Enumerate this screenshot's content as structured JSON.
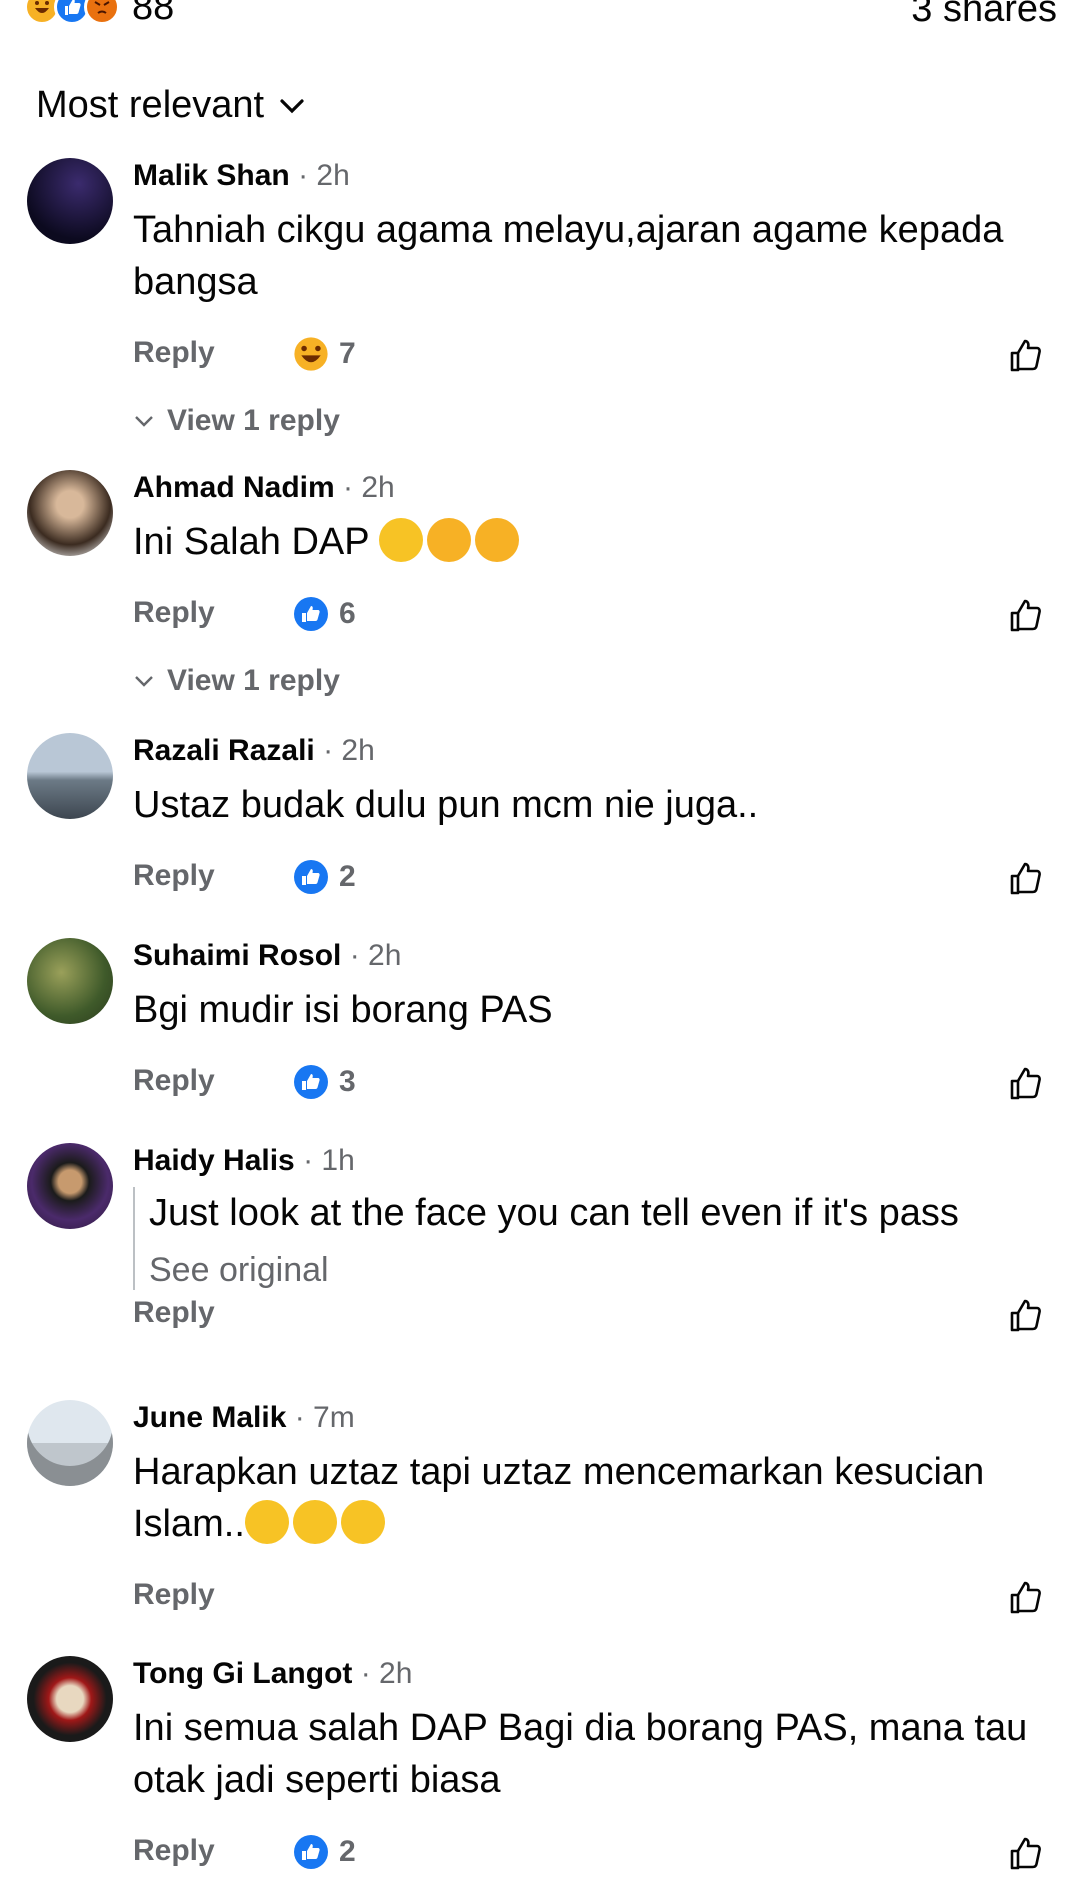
{
  "header": {
    "reaction_count": "88",
    "shares": "3 shares",
    "reaction_icons": [
      "haha-icon",
      "like-icon",
      "angry-icon"
    ]
  },
  "sort": {
    "label": "Most relevant"
  },
  "comments": [
    {
      "name": "Malik Shan",
      "time": "· 2h",
      "text": "Tahniah cikgu agama melayu,ajaran agame kepada bangsa",
      "reply": "Reply",
      "reaction": "haha",
      "count": "7",
      "view_replies": "View 1 reply"
    },
    {
      "name": "Ahmad Nadim",
      "time": "· 2h",
      "text": "Ini Salah DAP",
      "reply": "Reply",
      "reaction": "like",
      "count": "6",
      "view_replies": "View 1 reply"
    },
    {
      "name": "Razali Razali",
      "time": "· 2h",
      "text": "Ustaz budak dulu pun mcm nie juga..",
      "reply": "Reply",
      "reaction": "like",
      "count": "2"
    },
    {
      "name": "Suhaimi Rosol",
      "time": "· 2h",
      "text": "Bgi mudir isi borang PAS",
      "reply": "Reply",
      "reaction": "like",
      "count": "3"
    },
    {
      "name": "Haidy Halis",
      "time": "· 1h",
      "text": "Just look at the face you can tell even if it's pass",
      "see_original": "See original",
      "reply": "Reply"
    },
    {
      "name": "June Malik",
      "time": "· 7m",
      "text": "Harapkan uztaz tapi uztaz mencemarkan kesucian Islam..",
      "reply": "Reply"
    },
    {
      "name": "Tong Gi Langot",
      "time": "· 2h",
      "text": "Ini semua salah DAP Bagi dia borang PAS, mana tau otak jadi seperti biasa",
      "reply": "Reply",
      "reaction": "like",
      "count": "2"
    }
  ],
  "colors": {
    "like_blue": "#1877f2",
    "muted": "#65676b",
    "text": "#050505"
  }
}
